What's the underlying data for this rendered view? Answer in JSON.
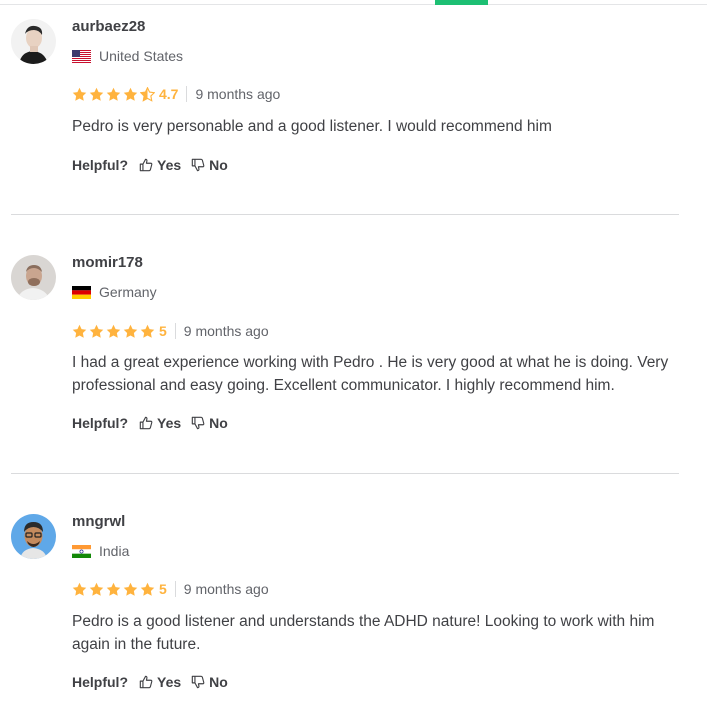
{
  "accent_color": "#1dbf73",
  "star_color": "#ffb33e",
  "helpful": {
    "label": "Helpful?",
    "yes": "Yes",
    "no": "No"
  },
  "reviews": [
    {
      "username": "aurbaez28",
      "country": "United States",
      "flag_icon": "us-flag-icon",
      "rating": "4.7",
      "stars": 4.5,
      "time_ago": "9 months ago",
      "text": "Pedro is very personable and a good listener. I would recommend him"
    },
    {
      "username": "momir178",
      "country": "Germany",
      "flag_icon": "germany-flag-icon",
      "rating": "5",
      "stars": 5,
      "time_ago": "9 months ago",
      "text": "I had a great experience working with Pedro . He is very good at what he is doing. Very professional and easy going. Excellent communicator. I highly recommend him."
    },
    {
      "username": "mngrwl",
      "country": "India",
      "flag_icon": "india-flag-icon",
      "rating": "5",
      "stars": 5,
      "time_ago": "9 months ago",
      "text": "Pedro is a good listener and understands the ADHD nature! Looking to work with him again in the future."
    }
  ]
}
